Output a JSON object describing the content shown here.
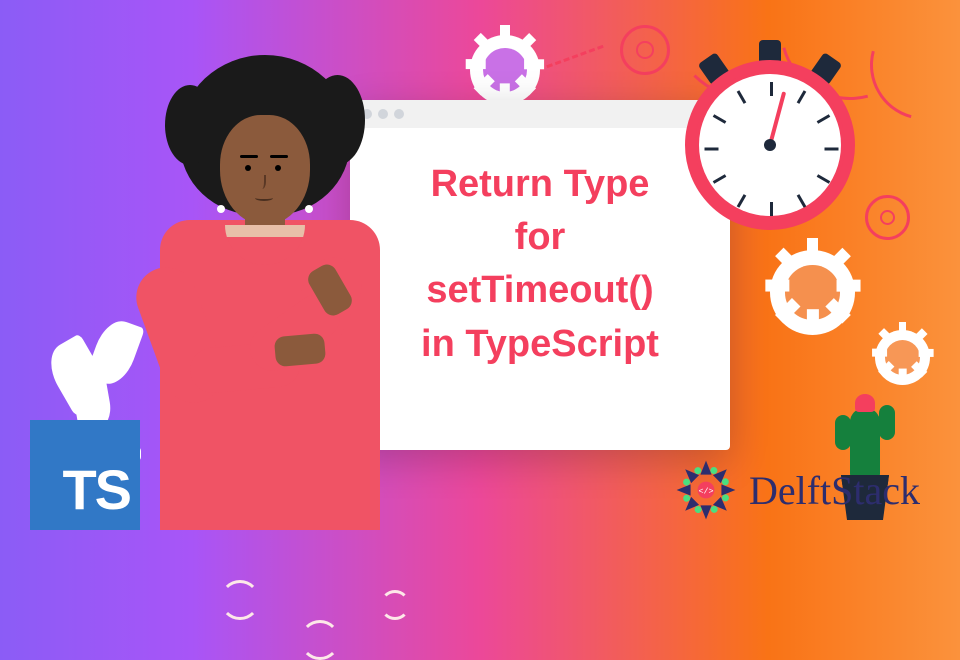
{
  "card": {
    "line1": "Return Type",
    "line2": "for",
    "line3": "setTimeout()",
    "line4": "in TypeScript"
  },
  "badges": {
    "ts": "TS",
    "brand": "DelftStack"
  },
  "colors": {
    "accent": "#F43F5E",
    "ts_bg": "#3178C6",
    "brand_text": "#2d2d6e"
  }
}
